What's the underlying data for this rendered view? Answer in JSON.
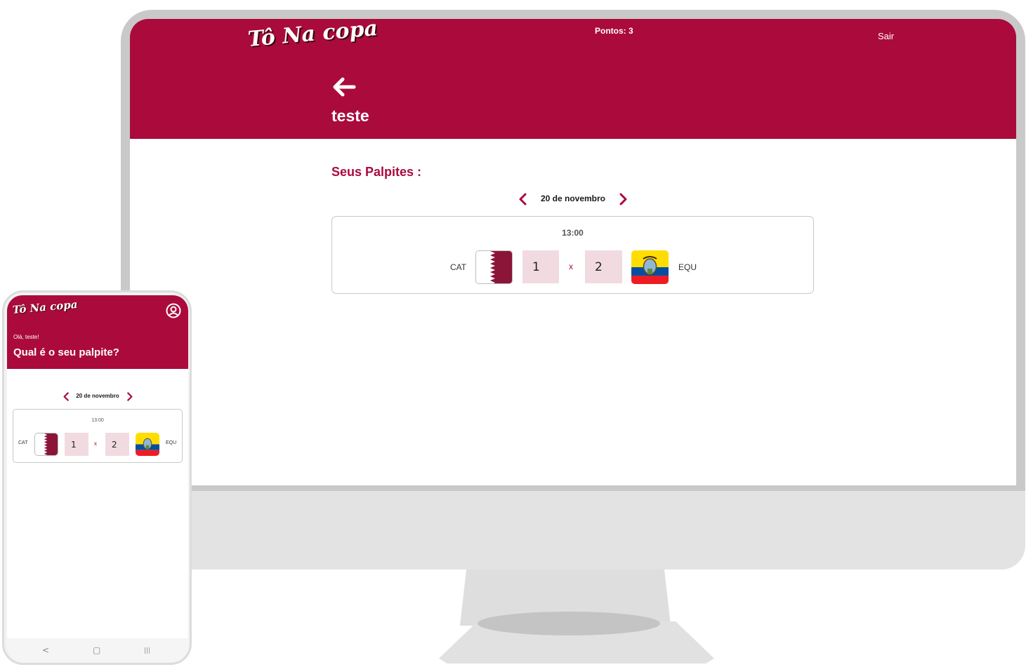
{
  "desktop": {
    "header": {
      "logo_text": "Tô Na copa",
      "points_label": "Pontos: 3",
      "logout_label": "Sair",
      "user_title": "teste",
      "back_icon": "arrow-left-icon"
    },
    "section_title": "Seus Palpites :",
    "date_label": "20 de novembro",
    "match": {
      "time": "13:00",
      "home_code": "CAT",
      "home_score": "1",
      "separator": "x",
      "away_score": "2",
      "away_code": "EQU"
    }
  },
  "phone": {
    "header": {
      "logo_text": "Tô Na copa",
      "greeting": "Olá, teste!",
      "question": "Qual é o seu palpite?",
      "user_icon": "user-circle-icon"
    },
    "date_label": "20 de novembro",
    "match": {
      "time": "13:00",
      "home_code": "CAT",
      "home_score": "1",
      "separator": "x",
      "away_score": "2",
      "away_code": "EQU"
    },
    "nav": {
      "back": "<",
      "home": "▢",
      "recent": "|||"
    }
  },
  "colors": {
    "brand": "#ab0a3d",
    "score_bg": "#f1dbe1",
    "qatar_maroon": "#8a1538",
    "ecuador_yellow": "#ffdd00",
    "ecuador_blue": "#034ea2",
    "ecuador_red": "#ed1c24"
  }
}
